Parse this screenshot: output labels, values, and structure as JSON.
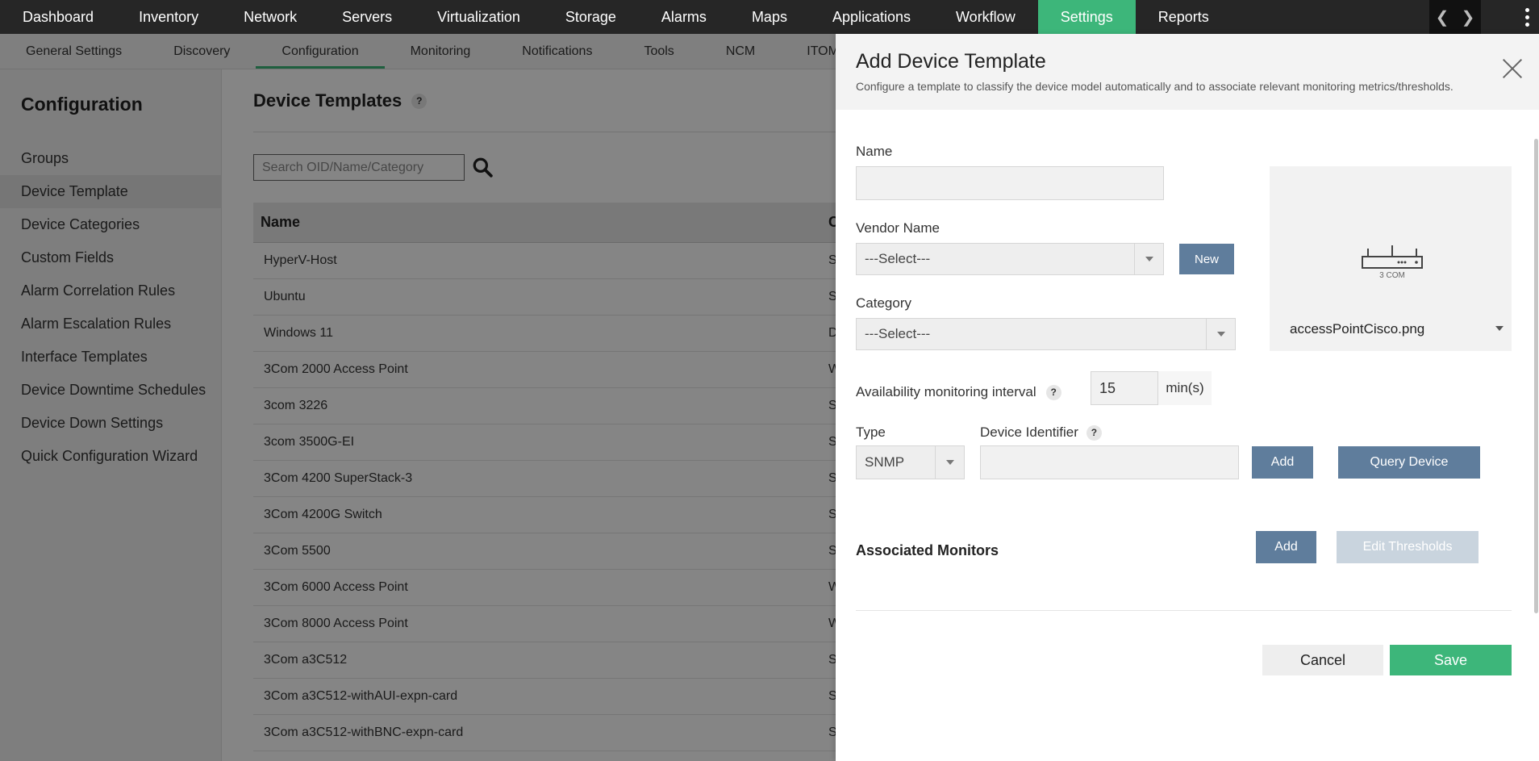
{
  "topnav": {
    "items": [
      "Dashboard",
      "Inventory",
      "Network",
      "Servers",
      "Virtualization",
      "Storage",
      "Alarms",
      "Maps",
      "Applications",
      "Workflow",
      "Settings",
      "Reports"
    ],
    "active": "Settings",
    "accent": "#3db67a"
  },
  "subnav": {
    "items": [
      "General Settings",
      "Discovery",
      "Configuration",
      "Monitoring",
      "Notifications",
      "Tools",
      "NCM",
      "ITOM"
    ],
    "active": "Configuration"
  },
  "sidebar": {
    "title": "Configuration",
    "items": [
      "Groups",
      "Device Template",
      "Device Categories",
      "Custom Fields",
      "Alarm Correlation Rules",
      "Alarm Escalation Rules",
      "Interface Templates",
      "Device Downtime Schedules",
      "Device Down Settings",
      "Quick Configuration Wizard"
    ],
    "active": "Device Template"
  },
  "main": {
    "title": "Device Templates",
    "help": "?",
    "search_placeholder": "Search OID/Name/Category",
    "table": {
      "columns": [
        "Name",
        "C"
      ],
      "rows": [
        {
          "name": "HyperV-Host",
          "cat": "S"
        },
        {
          "name": "Ubuntu",
          "cat": "S"
        },
        {
          "name": "Windows 11",
          "cat": "D"
        },
        {
          "name": "3Com 2000 Access Point",
          "cat": "W"
        },
        {
          "name": "3com 3226",
          "cat": "S"
        },
        {
          "name": "3com 3500G-EI",
          "cat": "S"
        },
        {
          "name": "3Com 4200 SuperStack-3",
          "cat": "S"
        },
        {
          "name": "3Com 4200G Switch",
          "cat": "S"
        },
        {
          "name": "3Com 5500",
          "cat": "S"
        },
        {
          "name": "3Com 6000 Access Point",
          "cat": "W"
        },
        {
          "name": "3Com 8000 Access Point",
          "cat": "W"
        },
        {
          "name": "3Com a3C512",
          "cat": "S"
        },
        {
          "name": "3Com a3C512-withAUI-expn-card",
          "cat": "S"
        },
        {
          "name": "3Com a3C512-withBNC-expn-card",
          "cat": "S"
        }
      ]
    }
  },
  "drawer": {
    "title": "Add Device Template",
    "description": "Configure a template to classify the device model automatically and to associate relevant monitoring metrics/thresholds.",
    "name_label": "Name",
    "name_value": "",
    "vendor_label": "Vendor Name",
    "vendor_value": "---Select---",
    "vendor_new_button": "New",
    "category_label": "Category",
    "category_value": "---Select---",
    "image_file": "accessPointCisco.png",
    "image_brand_text": "3 COM",
    "interval_label": "Availability monitoring interval",
    "interval_help": "?",
    "interval_value": "15",
    "interval_unit": "min(s)",
    "type_label": "Type",
    "type_value": "SNMP",
    "identifier_label": "Device Identifier",
    "identifier_help": "?",
    "identifier_value": "",
    "identifier_add_button": "Add",
    "query_device_button": "Query Device",
    "monitors_title": "Associated Monitors",
    "monitors_add_button": "Add",
    "edit_thresholds_button": "Edit Thresholds",
    "cancel_button": "Cancel",
    "save_button": "Save"
  }
}
